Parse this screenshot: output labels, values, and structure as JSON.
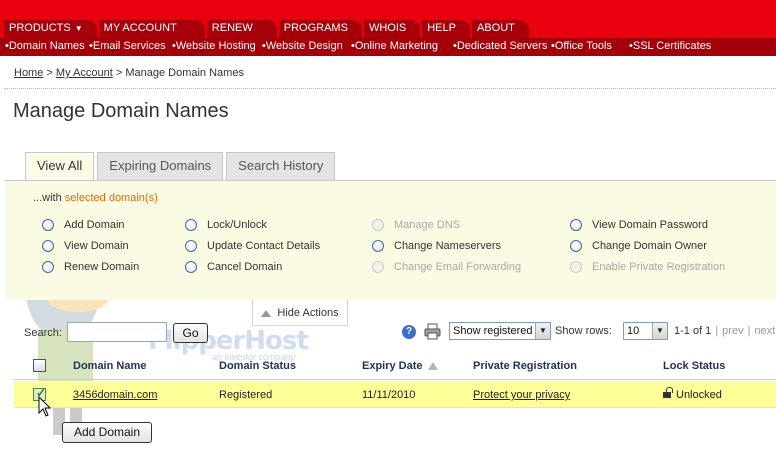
{
  "top_nav": [
    {
      "label": "PRODUCTS",
      "has_dropdown": true
    },
    {
      "label": "MY ACCOUNT"
    },
    {
      "label": "RENEW"
    },
    {
      "label": "PROGRAMS"
    },
    {
      "label": "WHOIS"
    },
    {
      "label": "HELP"
    },
    {
      "label": "ABOUT"
    }
  ],
  "sub_nav": [
    "•Domain Names",
    "•Email Services",
    "•Website Hosting",
    "•Website Design",
    "•Online Marketing",
    "•Dedicated Servers",
    "•Office Tools",
    "•SSL Certificates"
  ],
  "breadcrumb": {
    "home": "Home",
    "sep1": ">",
    "account": "My Account",
    "sep2": ">",
    "current": "Manage Domain Names"
  },
  "page_title": "Manage Domain Names",
  "tabs": [
    {
      "label": "View All",
      "active": true
    },
    {
      "label": "Expiring Domains"
    },
    {
      "label": "Search History"
    }
  ],
  "actions_panel": {
    "with_prefix": "...with ",
    "with_selected": "selected domain(s)",
    "actions": [
      {
        "label": "Add Domain",
        "enabled": true
      },
      {
        "label": "View Domain",
        "enabled": true
      },
      {
        "label": "Renew Domain",
        "enabled": true
      },
      {
        "label": "Lock/Unlock",
        "enabled": true
      },
      {
        "label": "Update Contact Details",
        "enabled": true
      },
      {
        "label": "Cancel Domain",
        "enabled": true
      },
      {
        "label": "Manage DNS",
        "enabled": false
      },
      {
        "label": "Change Nameservers",
        "enabled": true
      },
      {
        "label": "Change Email Forwarding",
        "enabled": false
      },
      {
        "label": "View Domain Password",
        "enabled": true
      },
      {
        "label": "Change Domain Owner",
        "enabled": true
      },
      {
        "label": "Enable Private Registration",
        "enabled": false
      }
    ],
    "hide_label": "Hide Actions"
  },
  "search": {
    "label": "Search:",
    "value": "",
    "go_label": "Go"
  },
  "toolbar": {
    "help_icon": "?",
    "show_filter": "Show registered",
    "rows_label": "Show rows:",
    "rows_value": "10",
    "page_info": "1-1 of 1",
    "prev": "prev",
    "next": "next"
  },
  "table": {
    "headers": {
      "domain_name": "Domain Name",
      "domain_status": "Domain Status",
      "expiry_date": "Expiry Date",
      "private_registration": "Private Registration",
      "lock_status": "Lock Status"
    },
    "rows": [
      {
        "checked": true,
        "domain_name": "3456domain.com",
        "domain_status": "Registered",
        "expiry_date": "11/11/2010",
        "private_registration": "Protect your privacy",
        "lock_status": "Unlocked"
      }
    ]
  },
  "add_domain_button": "Add Domain",
  "watermark": {
    "brand": "FlipperHost",
    "tagline": "an investor company"
  },
  "colors": {
    "nav_red": "#e8000e",
    "nav_dark_red": "#a3000a",
    "panel_yellow": "#fbfbe3",
    "row_highlight": "#ffff99",
    "accent_orange": "#e36a00"
  }
}
